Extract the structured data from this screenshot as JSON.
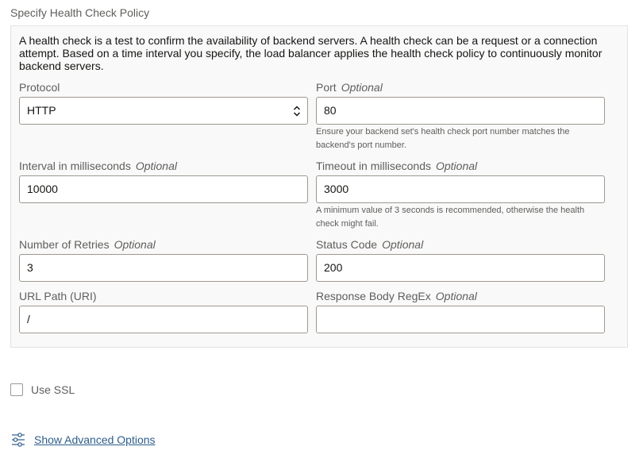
{
  "section": {
    "title": "Specify Health Check Policy",
    "intro": "A health check is a test to confirm the availability of backend servers. A health check can be a request or a connection attempt. Based on a time interval you specify, the load balancer applies the health check policy to continuously monitor backend servers."
  },
  "optional_label": "Optional",
  "fields": {
    "protocol": {
      "label": "Protocol",
      "value": "HTTP"
    },
    "port": {
      "label": "Port",
      "value": "80",
      "hint": "Ensure your backend set's health check port number matches the backend's port number."
    },
    "interval": {
      "label": "Interval in milliseconds",
      "value": "10000"
    },
    "timeout": {
      "label": "Timeout in milliseconds",
      "value": "3000",
      "hint": "A minimum value of 3 seconds is recommended, otherwise the health check might fail."
    },
    "retries": {
      "label": "Number of Retries",
      "value": "3"
    },
    "status_code": {
      "label": "Status Code",
      "value": "200"
    },
    "url_path": {
      "label": "URL Path (URI)",
      "value": "/"
    },
    "response_regex": {
      "label": "Response Body RegEx",
      "value": ""
    }
  },
  "ssl": {
    "label": "Use SSL",
    "checked": false
  },
  "advanced": {
    "link_label": "Show Advanced Options",
    "icon": "sliders-icon"
  },
  "colors": {
    "panel_bg": "#f9f9f9",
    "border": "#9e9892",
    "label": "#5f5e5c",
    "link": "#2c5d8a"
  }
}
